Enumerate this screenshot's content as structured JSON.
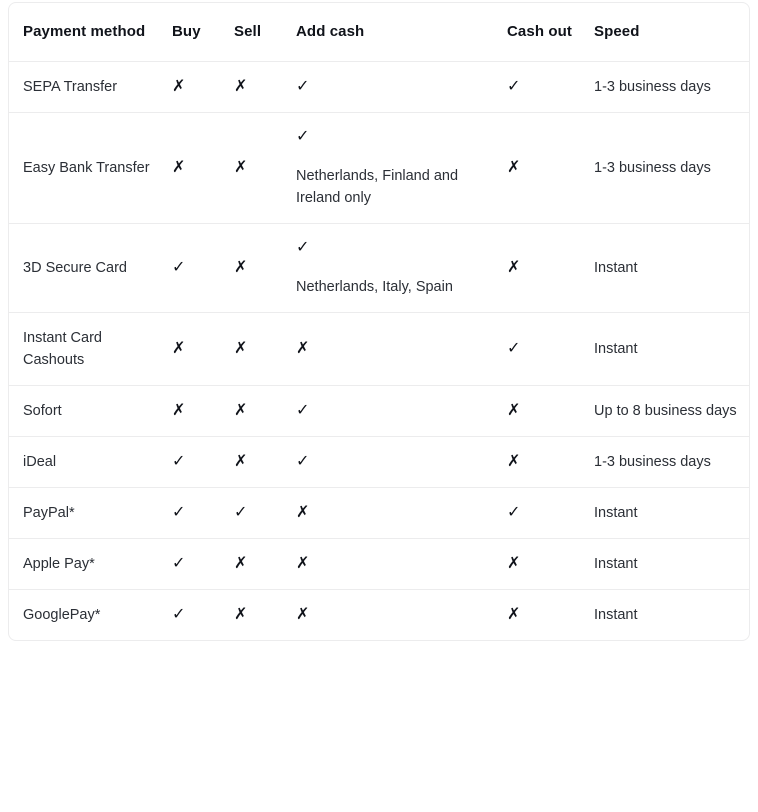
{
  "table": {
    "columns": [
      {
        "key": "method",
        "label": "Payment method"
      },
      {
        "key": "buy",
        "label": "Buy"
      },
      {
        "key": "sell",
        "label": "Sell"
      },
      {
        "key": "addcash",
        "label": "Add cash"
      },
      {
        "key": "cashout",
        "label": "Cash out"
      },
      {
        "key": "speed",
        "label": "Speed"
      }
    ],
    "glyphs": {
      "yes": "✓",
      "no": "✗",
      "none": ""
    },
    "rows": [
      {
        "method": "SEPA Transfer",
        "buy": "✗",
        "sell": "✗",
        "addcash": "✓",
        "addcash_note": "",
        "cashout": "✓",
        "speed": "1-3 business days"
      },
      {
        "method": "Easy Bank Transfer",
        "buy": "✗",
        "sell": "✗",
        "addcash": "✓",
        "addcash_note": "Netherlands, Finland and Ireland only",
        "cashout": "✗",
        "speed": "1-3 business days"
      },
      {
        "method": "3D Secure Card",
        "buy": "✓",
        "sell": "✗",
        "addcash": "✓",
        "addcash_note": "Netherlands, Italy, Spain",
        "cashout": "✗",
        "speed": "Instant"
      },
      {
        "method": "Instant Card Cashouts",
        "buy": "✗",
        "sell": "✗",
        "addcash": "✗",
        "addcash_note": "",
        "cashout": "✓",
        "speed": "Instant"
      },
      {
        "method": "Sofort",
        "buy": "✗",
        "sell": "✗",
        "addcash": "✓",
        "addcash_note": "",
        "cashout": "✗",
        "speed": "Up to 8 business days"
      },
      {
        "method": "iDeal",
        "buy": "✓",
        "sell": "✗",
        "addcash": "✓",
        "addcash_note": "",
        "cashout": "✗",
        "speed": "1-3 business days"
      },
      {
        "method": "PayPal*",
        "buy": "✓",
        "sell": "✓",
        "addcash": "✗",
        "addcash_note": "",
        "cashout": "✓",
        "speed": "Instant"
      },
      {
        "method": "Apple Pay*",
        "buy": "✓",
        "sell": "✗",
        "addcash": "✗",
        "addcash_note": "",
        "cashout": "✗",
        "speed": "Instant"
      },
      {
        "method": "GooglePay*",
        "buy": "✓",
        "sell": "✗",
        "addcash": "✗",
        "addcash_note": "",
        "cashout": "✗",
        "speed": "Instant"
      }
    ]
  },
  "colors": {
    "text": "#2b2f36",
    "heading": "#10131a",
    "border": "#ececed",
    "background": "#ffffff"
  }
}
